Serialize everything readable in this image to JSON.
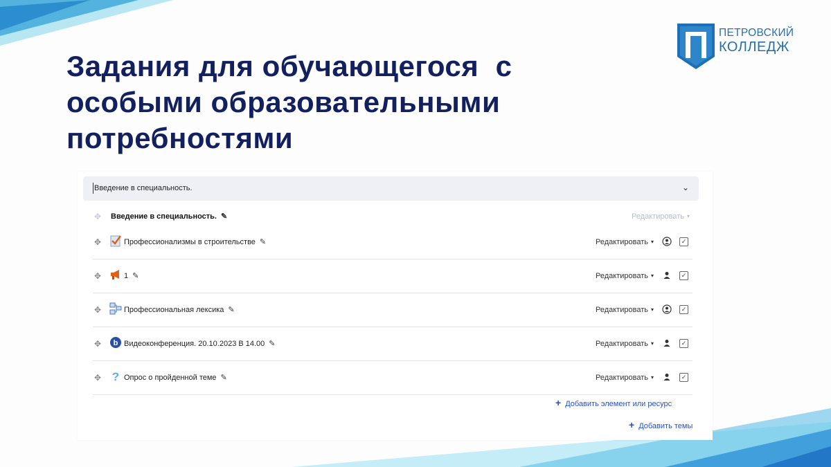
{
  "slide": {
    "title_line1": "Задания для обучающегося  с",
    "title_line2": "особыми образовательными",
    "title_line3": "потребностями"
  },
  "logo": {
    "line1": "ПЕТРОВСКИЙ",
    "line2": "КОЛЛЕДЖ",
    "letter": "П"
  },
  "course": {
    "section_header": "Введение в специальность.",
    "section_title": "Введение в специальность.",
    "section_edit": "Редактировать",
    "items": [
      {
        "name": "Профессионализмы в строительстве",
        "icon": "assignment-icon",
        "edit": "Редактировать",
        "availability": "group-icon"
      },
      {
        "name": "1",
        "icon": "announcement-icon",
        "edit": "Редактировать",
        "availability": "user-icon"
      },
      {
        "name": "Профессиональная лексика",
        "icon": "glossary-icon",
        "edit": "Редактировать",
        "availability": "group-icon"
      },
      {
        "name": "Видеоконференция. 20.10.2023 В 14.00",
        "icon": "bigbluebutton-icon",
        "edit": "Редактировать",
        "availability": "user-icon"
      },
      {
        "name": "Опрос о пройденной теме",
        "icon": "question-icon",
        "edit": "Редактировать",
        "availability": "user-icon"
      }
    ],
    "add_resource": "Добавить элемент или ресурс",
    "add_topic": "Добавить темы"
  },
  "colors": {
    "title": "#12205f",
    "logo_blue": "#1f6fb6",
    "link": "#2650c8",
    "header_bg": "#eef0f5"
  }
}
